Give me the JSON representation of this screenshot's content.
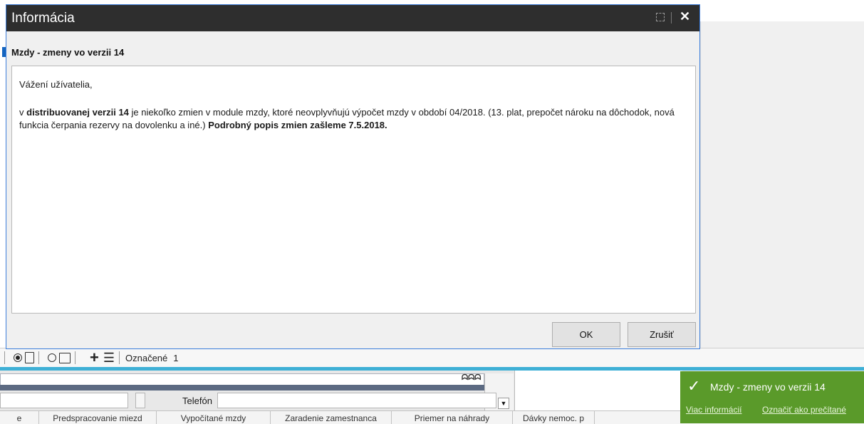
{
  "dialog": {
    "title": "Informácia",
    "subject": "Mzdy  - zmeny vo verzii 14",
    "greeting": "Vážení užívatelia,",
    "body": {
      "p1": " v ",
      "b1": "distribuovanej verzii 14",
      "p2": " je niekoľko zmien v module mzdy, ktoré neovplyvňujú výpočet mzdy v období 04/2018. (13. plat, prepočet nároku na dôchodok, nová funkcia čerpania rezervy na dovolenku a iné.) ",
      "b2": "Podrobný popis zmien zašleme 7.5.2018."
    },
    "buttons": {
      "ok": "OK",
      "cancel": "Zrušiť"
    }
  },
  "toolbar": {
    "marked_label": "Označené",
    "marked_count": "1"
  },
  "panel": {
    "phone_label": "Telefón",
    "icon_text": "ᗣᗣᗣ"
  },
  "tabs": [
    "e",
    "Predspracovanie miezd",
    "Vypočítané mzdy",
    "Zaradenie zamestnanca",
    "Priemer na náhrady",
    "Dávky nemoc. p"
  ],
  "notification": {
    "title": "Mzdy  - zmeny vo verzii 14",
    "link_more": "Viac informácií",
    "link_read": "Označiť ako prečítané",
    "color": "#5a9a2a"
  },
  "icons": {
    "check": "✓",
    "close": "✕",
    "plus": "+",
    "menu": "☰"
  }
}
